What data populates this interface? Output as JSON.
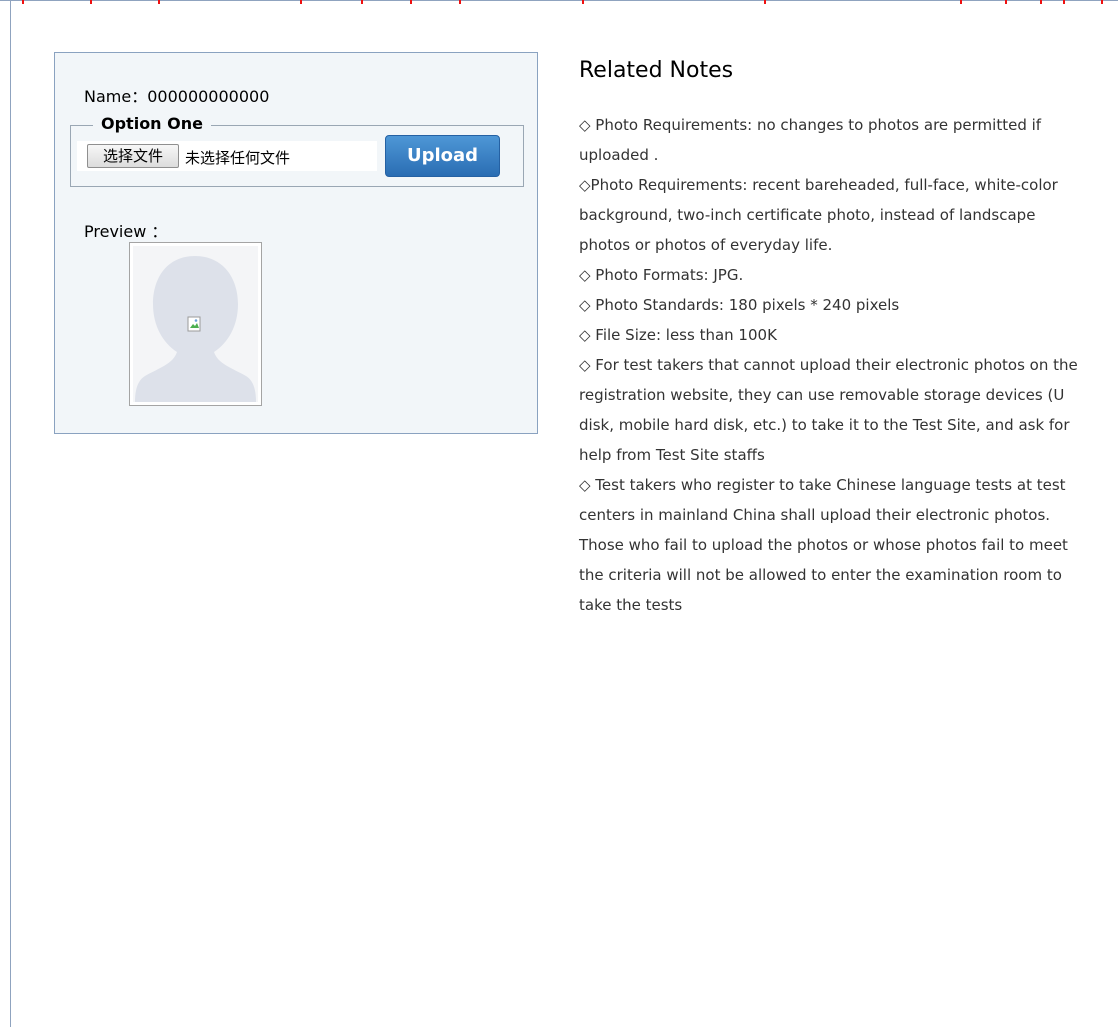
{
  "form": {
    "name_label": "Name：",
    "name_value": "000000000000",
    "option_legend": "Option One",
    "choose_file_label": "选择文件",
    "file_status": "未选择任何文件",
    "upload_label": "Upload",
    "preview_label": "Preview ："
  },
  "notes": {
    "title": "Related Notes",
    "items": [
      "◇ Photo Requirements: no changes to photos are permitted if uploaded .",
      "◇Photo Requirements: recent bareheaded, full-face, white-color background, two-inch certificate photo, instead of landscape photos or photos of everyday life.",
      "◇ Photo Formats: JPG.",
      "◇ Photo Standards: 180 pixels * 240 pixels",
      "◇ File Size: less than 100K",
      "◇ For test takers that cannot upload their electronic photos on the registration website, they can use removable storage devices (U disk, mobile hard disk, etc.) to take it to the Test Site, and ask for help from Test Site staffs",
      "◇ Test takers who register to take Chinese language tests at test centers in mainland China shall upload their electronic photos. Those who fail to upload the photos or whose photos fail to meet the criteria will not be allowed to enter the examination room to take the tests"
    ]
  },
  "colors": {
    "panel_bg": "#f2f6f9",
    "panel_border": "#8aa2c0",
    "upload_button": "#3a80c4",
    "notes_text": "#333333"
  }
}
